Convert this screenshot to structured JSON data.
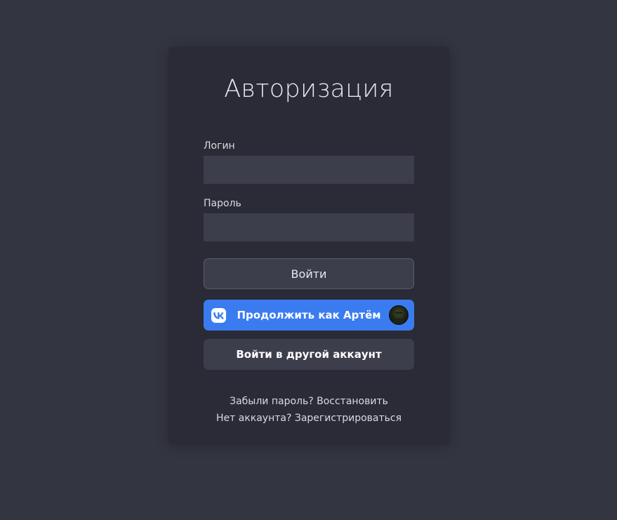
{
  "auth": {
    "title": "Авторизация",
    "login_label": "Логин",
    "login_value": "",
    "password_label": "Пароль",
    "password_value": "",
    "login_button": "Войти",
    "vk_button": "Продолжить как Артём",
    "other_account_button": "Войти в другой аккаунт",
    "forgot_text": "Забыли пароль?",
    "restore_link": "Восстановить",
    "no_account_text": "Нет аккаунта?",
    "register_link": "Зарегистрироваться"
  },
  "icons": {
    "vk": "vk-logo-icon",
    "avatar": "user-avatar"
  },
  "colors": {
    "page_bg": "#333541",
    "card_bg": "#2a2b36",
    "input_bg": "#3d3e4c",
    "vk_blue": "#3a7cf0",
    "text": "#e7e8ee"
  }
}
